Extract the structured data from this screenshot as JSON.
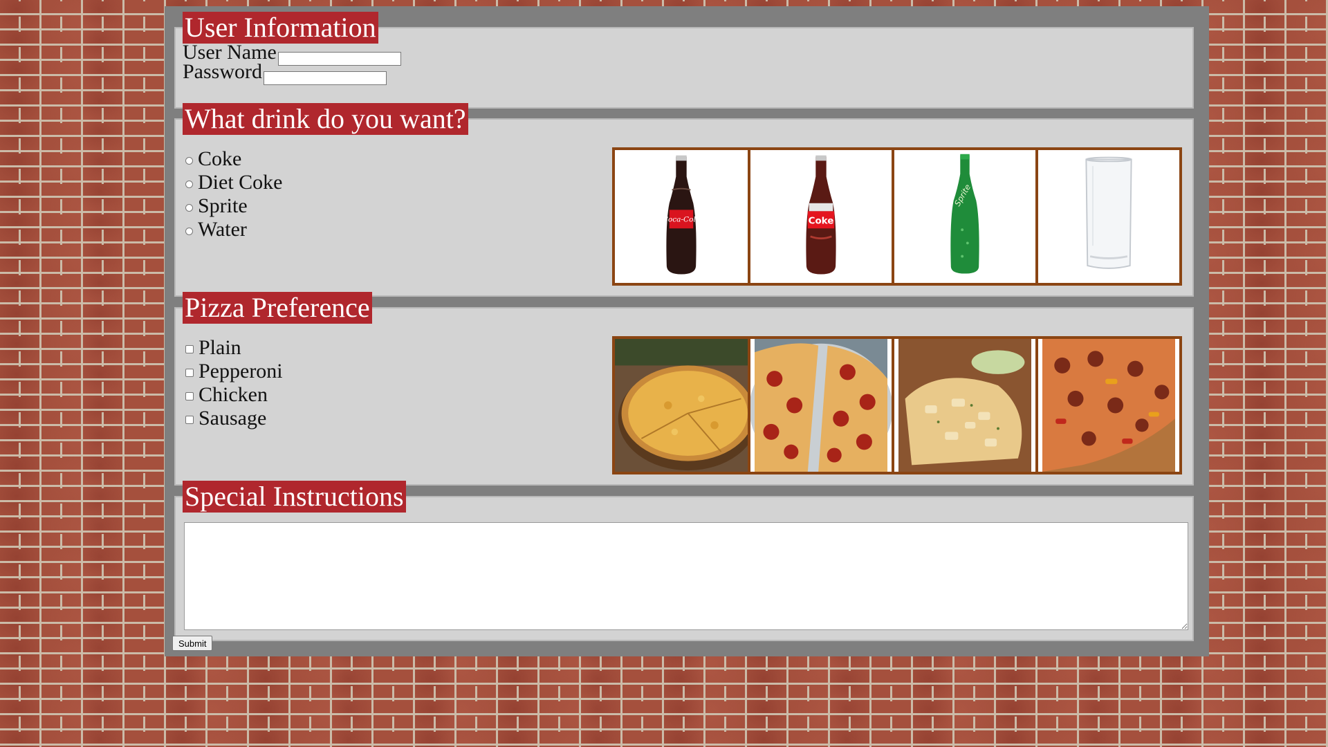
{
  "user_info": {
    "legend": "User Information",
    "username_label": "User Name",
    "username_value": "",
    "password_label": "Password",
    "password_value": ""
  },
  "drink": {
    "legend": "What drink do you want?",
    "options": [
      "Coke",
      "Diet Coke",
      "Sprite",
      "Water"
    ],
    "images": [
      "coke-bottle",
      "diet-coke-bottle",
      "sprite-bottle",
      "water-glass"
    ]
  },
  "pizza": {
    "legend": "Pizza Preference",
    "options": [
      "Plain",
      "Pepperoni",
      "Chicken",
      "Sausage"
    ],
    "images": [
      "plain-pizza",
      "pepperoni-pizza",
      "chicken-pizza",
      "sausage-pizza"
    ]
  },
  "instructions": {
    "legend": "Special Instructions",
    "value": ""
  },
  "submit_label": "Submit",
  "colors": {
    "legend_bg": "#b0272d",
    "panel_bg": "#d3d3d3",
    "frame_bg": "#7f7f7f",
    "tile_border": "#8b4513"
  }
}
